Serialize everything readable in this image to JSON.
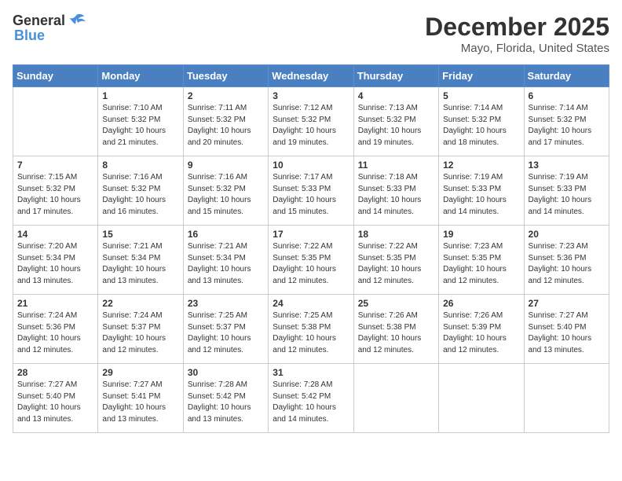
{
  "logo": {
    "general": "General",
    "blue": "Blue"
  },
  "header": {
    "title": "December 2025",
    "subtitle": "Mayo, Florida, United States"
  },
  "weekdays": [
    "Sunday",
    "Monday",
    "Tuesday",
    "Wednesday",
    "Thursday",
    "Friday",
    "Saturday"
  ],
  "weeks": [
    [
      {
        "day": "",
        "info": ""
      },
      {
        "day": "1",
        "info": "Sunrise: 7:10 AM\nSunset: 5:32 PM\nDaylight: 10 hours\nand 21 minutes."
      },
      {
        "day": "2",
        "info": "Sunrise: 7:11 AM\nSunset: 5:32 PM\nDaylight: 10 hours\nand 20 minutes."
      },
      {
        "day": "3",
        "info": "Sunrise: 7:12 AM\nSunset: 5:32 PM\nDaylight: 10 hours\nand 19 minutes."
      },
      {
        "day": "4",
        "info": "Sunrise: 7:13 AM\nSunset: 5:32 PM\nDaylight: 10 hours\nand 19 minutes."
      },
      {
        "day": "5",
        "info": "Sunrise: 7:14 AM\nSunset: 5:32 PM\nDaylight: 10 hours\nand 18 minutes."
      },
      {
        "day": "6",
        "info": "Sunrise: 7:14 AM\nSunset: 5:32 PM\nDaylight: 10 hours\nand 17 minutes."
      }
    ],
    [
      {
        "day": "7",
        "info": "Sunrise: 7:15 AM\nSunset: 5:32 PM\nDaylight: 10 hours\nand 17 minutes."
      },
      {
        "day": "8",
        "info": "Sunrise: 7:16 AM\nSunset: 5:32 PM\nDaylight: 10 hours\nand 16 minutes."
      },
      {
        "day": "9",
        "info": "Sunrise: 7:16 AM\nSunset: 5:32 PM\nDaylight: 10 hours\nand 15 minutes."
      },
      {
        "day": "10",
        "info": "Sunrise: 7:17 AM\nSunset: 5:33 PM\nDaylight: 10 hours\nand 15 minutes."
      },
      {
        "day": "11",
        "info": "Sunrise: 7:18 AM\nSunset: 5:33 PM\nDaylight: 10 hours\nand 14 minutes."
      },
      {
        "day": "12",
        "info": "Sunrise: 7:19 AM\nSunset: 5:33 PM\nDaylight: 10 hours\nand 14 minutes."
      },
      {
        "day": "13",
        "info": "Sunrise: 7:19 AM\nSunset: 5:33 PM\nDaylight: 10 hours\nand 14 minutes."
      }
    ],
    [
      {
        "day": "14",
        "info": "Sunrise: 7:20 AM\nSunset: 5:34 PM\nDaylight: 10 hours\nand 13 minutes."
      },
      {
        "day": "15",
        "info": "Sunrise: 7:21 AM\nSunset: 5:34 PM\nDaylight: 10 hours\nand 13 minutes."
      },
      {
        "day": "16",
        "info": "Sunrise: 7:21 AM\nSunset: 5:34 PM\nDaylight: 10 hours\nand 13 minutes."
      },
      {
        "day": "17",
        "info": "Sunrise: 7:22 AM\nSunset: 5:35 PM\nDaylight: 10 hours\nand 12 minutes."
      },
      {
        "day": "18",
        "info": "Sunrise: 7:22 AM\nSunset: 5:35 PM\nDaylight: 10 hours\nand 12 minutes."
      },
      {
        "day": "19",
        "info": "Sunrise: 7:23 AM\nSunset: 5:35 PM\nDaylight: 10 hours\nand 12 minutes."
      },
      {
        "day": "20",
        "info": "Sunrise: 7:23 AM\nSunset: 5:36 PM\nDaylight: 10 hours\nand 12 minutes."
      }
    ],
    [
      {
        "day": "21",
        "info": "Sunrise: 7:24 AM\nSunset: 5:36 PM\nDaylight: 10 hours\nand 12 minutes."
      },
      {
        "day": "22",
        "info": "Sunrise: 7:24 AM\nSunset: 5:37 PM\nDaylight: 10 hours\nand 12 minutes."
      },
      {
        "day": "23",
        "info": "Sunrise: 7:25 AM\nSunset: 5:37 PM\nDaylight: 10 hours\nand 12 minutes."
      },
      {
        "day": "24",
        "info": "Sunrise: 7:25 AM\nSunset: 5:38 PM\nDaylight: 10 hours\nand 12 minutes."
      },
      {
        "day": "25",
        "info": "Sunrise: 7:26 AM\nSunset: 5:38 PM\nDaylight: 10 hours\nand 12 minutes."
      },
      {
        "day": "26",
        "info": "Sunrise: 7:26 AM\nSunset: 5:39 PM\nDaylight: 10 hours\nand 12 minutes."
      },
      {
        "day": "27",
        "info": "Sunrise: 7:27 AM\nSunset: 5:40 PM\nDaylight: 10 hours\nand 13 minutes."
      }
    ],
    [
      {
        "day": "28",
        "info": "Sunrise: 7:27 AM\nSunset: 5:40 PM\nDaylight: 10 hours\nand 13 minutes."
      },
      {
        "day": "29",
        "info": "Sunrise: 7:27 AM\nSunset: 5:41 PM\nDaylight: 10 hours\nand 13 minutes."
      },
      {
        "day": "30",
        "info": "Sunrise: 7:28 AM\nSunset: 5:42 PM\nDaylight: 10 hours\nand 13 minutes."
      },
      {
        "day": "31",
        "info": "Sunrise: 7:28 AM\nSunset: 5:42 PM\nDaylight: 10 hours\nand 14 minutes."
      },
      {
        "day": "",
        "info": ""
      },
      {
        "day": "",
        "info": ""
      },
      {
        "day": "",
        "info": ""
      }
    ]
  ]
}
